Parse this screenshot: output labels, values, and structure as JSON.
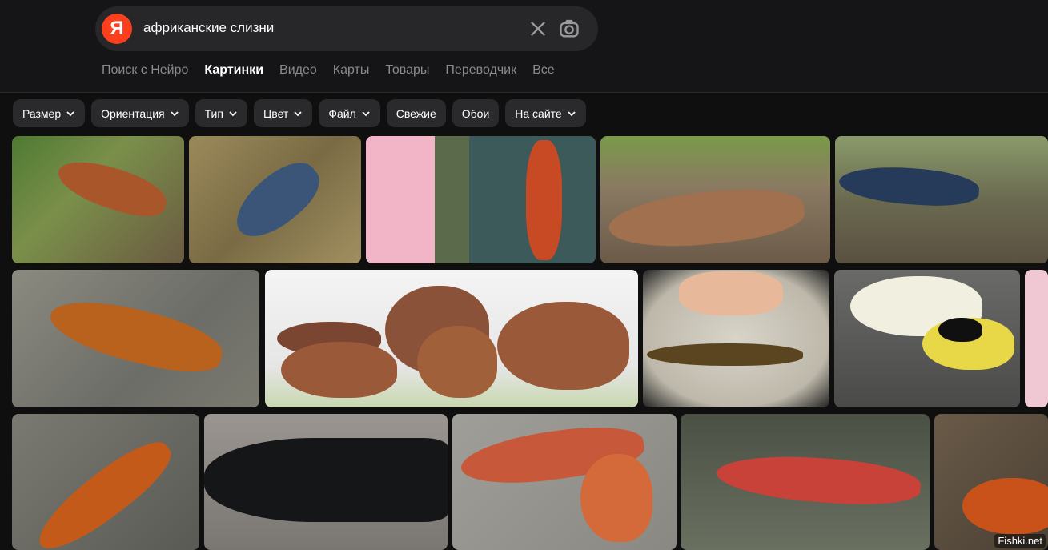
{
  "search": {
    "logo": "Я",
    "query": "африканские слизни"
  },
  "icons": {
    "clear": "close-icon",
    "camera": "camera-icon",
    "chevron": "chevron-down-icon"
  },
  "tabs": [
    "Поиск с Нейро",
    "Картинки",
    "Видео",
    "Карты",
    "Товары",
    "Переводчик",
    "Все"
  ],
  "active_tab": "Картинки",
  "filters": [
    "Размер",
    "Ориентация",
    "Тип",
    "Цвет",
    "Файл",
    "Свежие",
    "Обои",
    "На сайте"
  ],
  "watermark": "Fishki.net",
  "colors": {
    "accent": "#fc3f1d",
    "background": "#0f0f10",
    "chip": "#2a2a2d"
  }
}
